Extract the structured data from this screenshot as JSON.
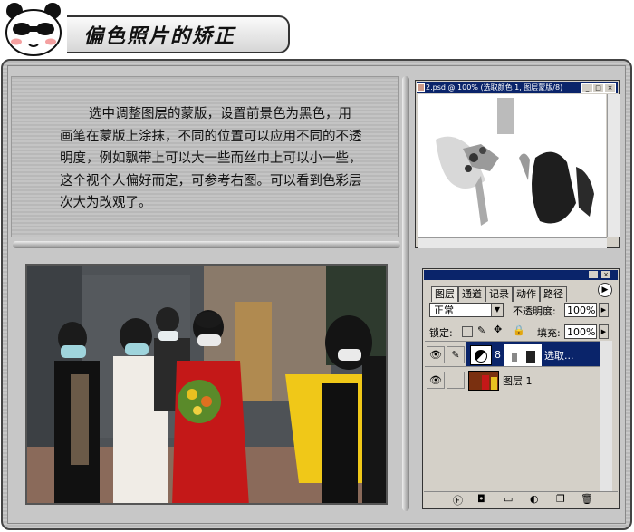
{
  "header": {
    "title": "偏色照片的矫正"
  },
  "body_text": "选中调整图层的蒙版，设置前景色为黑色，用画笔在蒙版上涂抹，不同的位置可以应用不同的不透明度，例如飘带上可以大一些而丝巾上可以小一些，这个视个人偏好而定，可参考右图。可以看到色彩层次大为改观了。",
  "document_window": {
    "title": "2.psd @ 100% (选取颜色 1, 图层蒙版/8)"
  },
  "layers_panel": {
    "tabs": [
      "图层",
      "通道",
      "记录",
      "动作",
      "路径"
    ],
    "blend_mode": "正常",
    "opacity_label": "不透明度:",
    "opacity_value": "100%",
    "lock_label": "锁定:",
    "fill_label": "填充:",
    "fill_value": "100%",
    "layers": [
      {
        "name": "选取...",
        "selected": true
      },
      {
        "name": "图层 1",
        "selected": false
      }
    ]
  },
  "colors": {
    "selection": "#0a246a",
    "panel": "#d4d0c8"
  }
}
